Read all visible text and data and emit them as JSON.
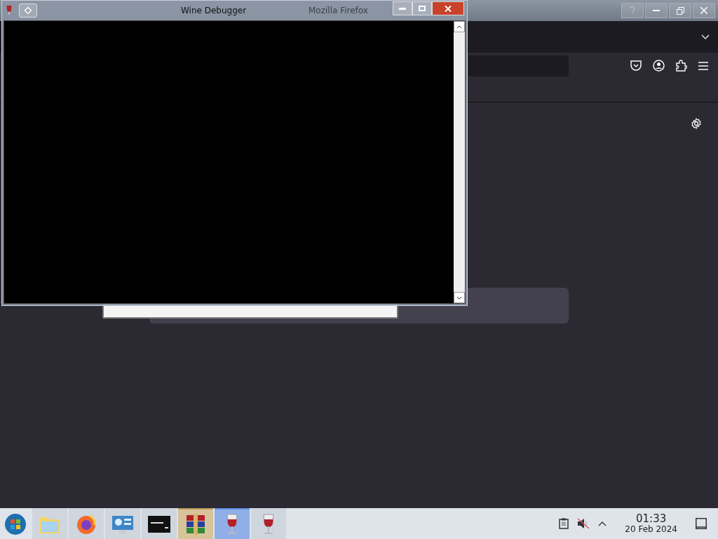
{
  "background_window": {
    "title": "Mozilla Firefox"
  },
  "debugger_window": {
    "title": "Wine Debugger"
  },
  "taskbar": {
    "apps": [
      {
        "kind": "start",
        "selected": false,
        "attention": false
      },
      {
        "kind": "folder",
        "selected": false,
        "attention": false
      },
      {
        "kind": "firefox",
        "selected": false,
        "attention": false
      },
      {
        "kind": "settings",
        "selected": false,
        "attention": false
      },
      {
        "kind": "terminal",
        "selected": false,
        "attention": false
      },
      {
        "kind": "archive",
        "selected": false,
        "attention": true
      },
      {
        "kind": "wine",
        "selected": true,
        "attention": false
      },
      {
        "kind": "wine",
        "selected": false,
        "attention": false
      }
    ],
    "clock": {
      "time": "01:33",
      "date": "20 Feb 2024"
    }
  }
}
